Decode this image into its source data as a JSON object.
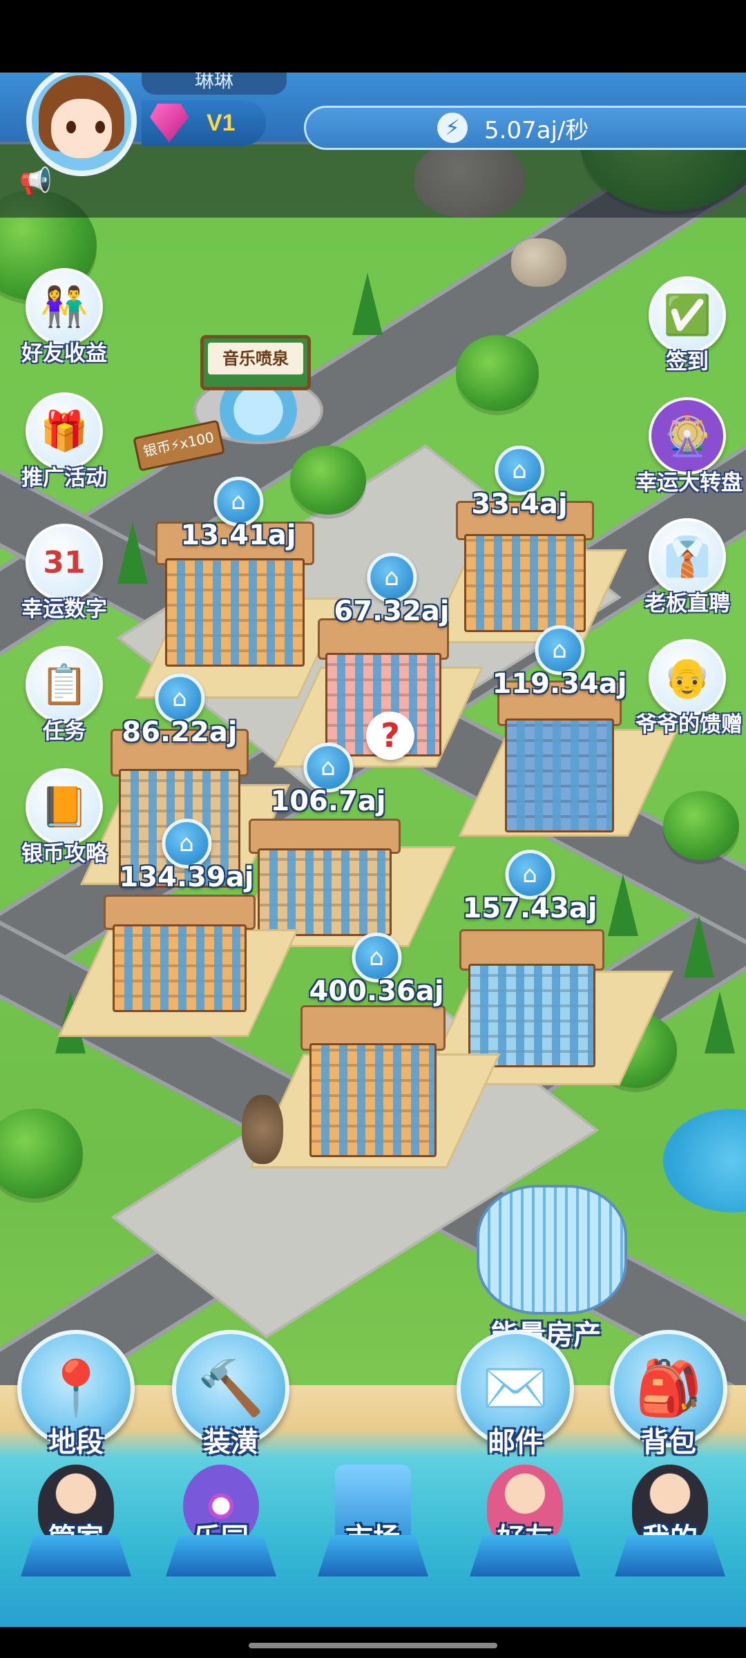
{
  "header": {
    "username": "琳琳",
    "vip_level": "V1",
    "income_rate": "5.07aj/秒"
  },
  "landmarks": {
    "fountain_sign": "音乐喷泉",
    "silver_coin_sign": "银币⚡x100",
    "energy_house": "能量房产"
  },
  "buildings": [
    {
      "income": "13.41aj"
    },
    {
      "income": "33.4aj"
    },
    {
      "income": "67.32aj"
    },
    {
      "income": "119.34aj"
    },
    {
      "income": "86.22aj"
    },
    {
      "income": "106.7aj"
    },
    {
      "income": "134.39aj"
    },
    {
      "income": "157.43aj"
    },
    {
      "income": "400.36aj"
    }
  ],
  "left_menu": [
    {
      "label": "好友收益",
      "icon": "friends-icon"
    },
    {
      "label": "推广活动",
      "icon": "gift-icon"
    },
    {
      "label": "幸运数字",
      "icon": "calendar-icon",
      "badge": "31"
    },
    {
      "label": "任务",
      "icon": "task-list-icon"
    },
    {
      "label": "银币攻略",
      "icon": "guide-book-icon"
    }
  ],
  "right_menu": [
    {
      "label": "签到",
      "icon": "checkin-calendar-icon"
    },
    {
      "label": "幸运大转盘",
      "icon": "lucky-wheel-icon"
    },
    {
      "label": "老板直聘",
      "icon": "boss-avatar-icon"
    },
    {
      "label": "爷爷的馈赠",
      "icon": "grandpa-avatar-icon"
    }
  ],
  "actions": [
    {
      "label": "地段",
      "icon": "map-pin-icon"
    },
    {
      "label": "装潢",
      "icon": "hammer-icon"
    },
    {
      "label": "邮件",
      "icon": "mail-icon"
    },
    {
      "label": "背包",
      "icon": "backpack-icon"
    }
  ],
  "bottom_nav": [
    {
      "label": "管家"
    },
    {
      "label": "乐园"
    },
    {
      "label": "市场"
    },
    {
      "label": "好友"
    },
    {
      "label": "我的"
    }
  ],
  "colors": {
    "hud_blue": "#2c6fb8",
    "grass": "#6fbf4a",
    "vip_gold": "#ffd84a",
    "label_outline": "#1f3f7a"
  }
}
